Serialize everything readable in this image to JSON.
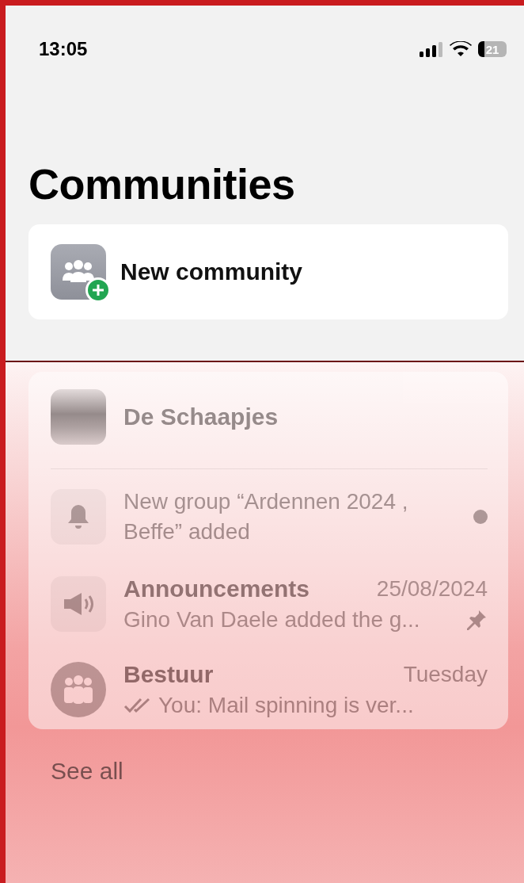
{
  "status_bar": {
    "time": "13:05",
    "battery": "21"
  },
  "title": "Communities",
  "new_community": {
    "label": "New community"
  },
  "community": {
    "name": "De Schaapjes",
    "rows": [
      {
        "kind": "notice",
        "text": "New group “Ardennen 2024 , Beffe” added",
        "unread": true
      },
      {
        "kind": "announcement",
        "name": "Announcements",
        "time": "25/08/2024",
        "preview": "Gino Van Daele added the g...",
        "pinned": true,
        "ticks": false
      },
      {
        "kind": "group",
        "name": "Bestuur",
        "time": "Tuesday",
        "preview": "You: Mail spinning is ver...",
        "pinned": false,
        "ticks": true
      }
    ],
    "see_all": "See all"
  }
}
